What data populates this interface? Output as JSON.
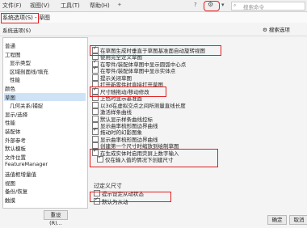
{
  "menubar": {
    "file": "文件(F)",
    "view": "视图(V)",
    "tools": "工具(T)",
    "help": "帮助(H)",
    "search_placeholder": "搜索命令"
  },
  "dialog": {
    "title": "系统选项(S) - 草图",
    "tab_label": "系统选项(S)",
    "search_options": "搜索选项"
  },
  "left_panel": {
    "items": [
      {
        "label": "普通",
        "sub": false,
        "selected": false
      },
      {
        "label": "工程图",
        "sub": false,
        "selected": false
      },
      {
        "label": "显示类型",
        "sub": true,
        "selected": false
      },
      {
        "label": "区域剖面线/填充",
        "sub": true,
        "selected": false
      },
      {
        "label": "性能",
        "sub": true,
        "selected": false
      },
      {
        "label": "颜色",
        "sub": false,
        "selected": false
      },
      {
        "label": "草图",
        "sub": false,
        "selected": true
      },
      {
        "label": "几何关系/捕捉",
        "sub": true,
        "selected": false
      },
      {
        "label": "显示/选择",
        "sub": false,
        "selected": false
      },
      {
        "label": "性能",
        "sub": false,
        "selected": false
      },
      {
        "label": "装配体",
        "sub": false,
        "selected": false
      },
      {
        "label": "外部参考",
        "sub": false,
        "selected": false
      },
      {
        "label": "默认模板",
        "sub": false,
        "selected": false
      },
      {
        "label": "文件位置",
        "sub": false,
        "selected": false
      },
      {
        "label": "FeatureManager",
        "sub": false,
        "selected": false
      },
      {
        "label": "选值框增量值",
        "sub": false,
        "selected": false
      },
      {
        "label": "视图",
        "sub": false,
        "selected": false
      },
      {
        "label": "备份/恢复",
        "sub": false,
        "selected": false
      },
      {
        "label": "触摸",
        "sub": false,
        "selected": false
      }
    ]
  },
  "options": [
    {
      "label": "在草图生成时垂直于草图基准面自动旋转视图",
      "checked": true,
      "indent": false
    },
    {
      "label": "使用完全定义草图",
      "checked": false,
      "indent": false
    },
    {
      "label": "在零件/装配体草图中显示圆弧中心点",
      "checked": true,
      "indent": false
    },
    {
      "label": "在零件/装配体草图中显示实体点",
      "checked": true,
      "indent": false
    },
    {
      "label": "提示关闭草图",
      "checked": false,
      "indent": false
    },
    {
      "label": "打开新零件时直接打开草图",
      "checked": false,
      "indent": false
    },
    {
      "label": "尺寸随拖动/移动修改",
      "checked": true,
      "indent": false
    },
    {
      "label": "上色时显示基准面",
      "checked": false,
      "indent": false
    },
    {
      "label": "以3d在虚拟交点之间所测量直线长度",
      "checked": false,
      "indent": false
    },
    {
      "label": "激活样条曲线",
      "checked": false,
      "indent": false
    },
    {
      "label": "默认显示样条曲线控标",
      "checked": false,
      "indent": false
    },
    {
      "label": "显示曲率梳形图边界曲线",
      "checked": false,
      "indent": false
    },
    {
      "label": "拖动时的幻影图象",
      "checked": true,
      "indent": false
    },
    {
      "label": "显示曲率梳形图边界曲线",
      "checked": false,
      "indent": false
    },
    {
      "label": "创建第一个尺寸时缩放到绘制草图",
      "checked": false,
      "indent": false
    },
    {
      "label": "在生成实体时启用荧屏上数字输入",
      "checked": true,
      "indent": false
    },
    {
      "label": "仅在输入值的情况下创建尺寸",
      "checked": true,
      "indent": true
    }
  ],
  "overdefine": {
    "title": "过定义尺寸",
    "options": [
      {
        "label": "提示设定从动状态",
        "checked": false
      },
      {
        "label": "默认为从动",
        "checked": true
      }
    ]
  },
  "buttons": {
    "reset": "重设(R)...",
    "ok": "确定",
    "cancel": "取消"
  }
}
